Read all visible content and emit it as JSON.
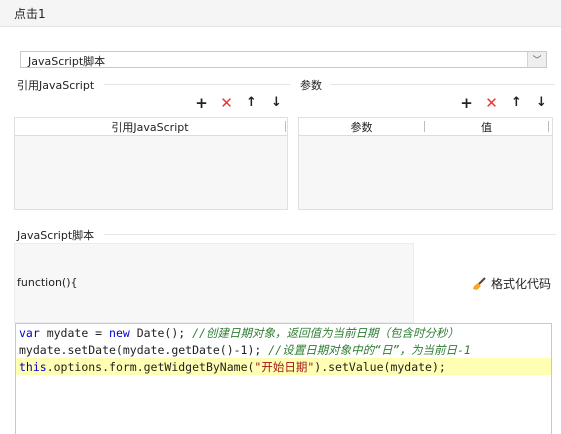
{
  "window": {
    "title": "点击1"
  },
  "action_select": {
    "value": "JavaScript脚本",
    "arrow": "﹀"
  },
  "imports": {
    "label": "引用JavaScript",
    "toolbar": {
      "add": "+",
      "delete": "✕",
      "up": "↑",
      "down": "↓"
    },
    "columns": [
      "引用JavaScript"
    ]
  },
  "params": {
    "label": "参数",
    "toolbar": {
      "add": "+",
      "delete": "✕",
      "up": "↑",
      "down": "↓"
    },
    "columns": [
      "参数",
      "值"
    ]
  },
  "script": {
    "label": "JavaScript脚本",
    "function_header": "function(){",
    "format_button": "格式化代码",
    "code_lines": [
      [
        {
          "t": "var",
          "c": "kw"
        },
        {
          "t": " mydate = ",
          "c": ""
        },
        {
          "t": "new",
          "c": "kw"
        },
        {
          "t": " Date(); ",
          "c": ""
        },
        {
          "t": "//创建日期对象，返回值为当前日期（包含时分秒）",
          "c": "cm"
        }
      ],
      [
        {
          "t": "mydate.setDate(mydate.getDate()-1); ",
          "c": ""
        },
        {
          "t": "//设置日期对象中的“日”，为当前日-1",
          "c": "cm"
        }
      ],
      [
        {
          "t": "this",
          "c": "kw"
        },
        {
          "t": ".options.form.getWidgetByName(",
          "c": ""
        },
        {
          "t": "\"开始日期\"",
          "c": "st"
        },
        {
          "t": ").setValue(mydate);",
          "c": ""
        }
      ]
    ]
  }
}
